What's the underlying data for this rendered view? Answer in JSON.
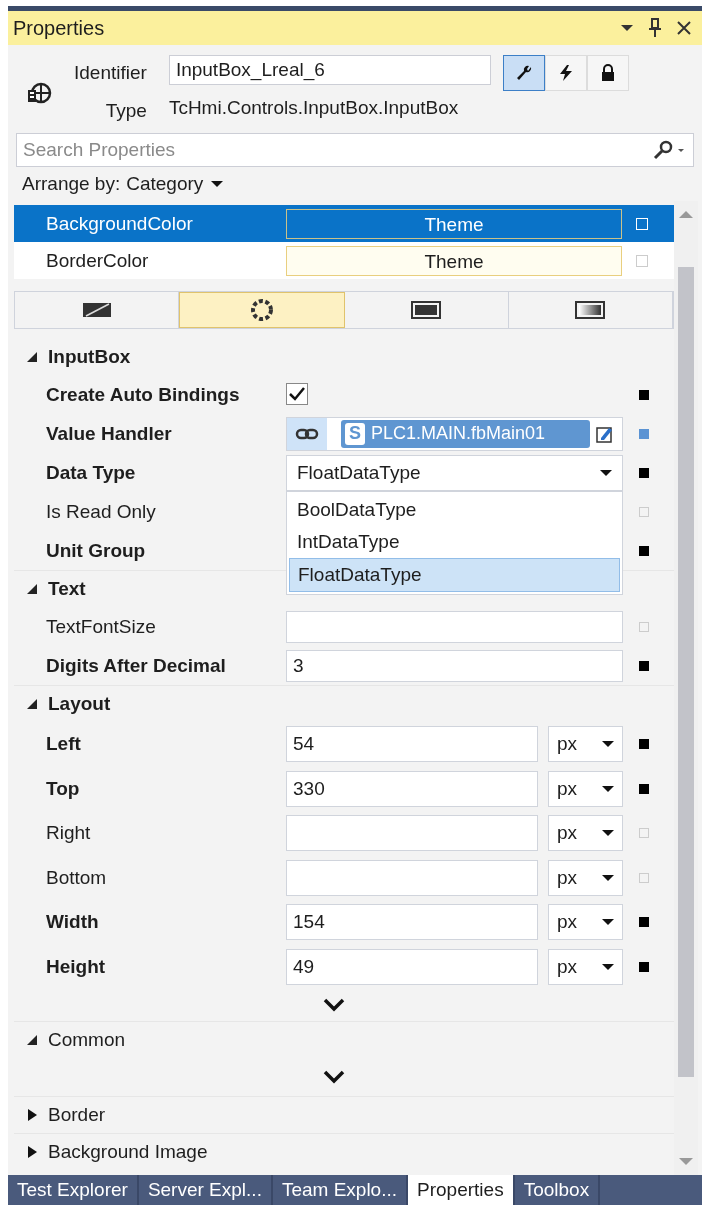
{
  "window": {
    "title": "Properties"
  },
  "header": {
    "identifier_label": "Identifier",
    "identifier": "InputBox_Lreal_6",
    "type_label": "Type",
    "type": "TcHmi.Controls.InputBox.InputBox",
    "views": [
      {
        "kind": "properties",
        "selected": true
      },
      {
        "kind": "events",
        "selected": false
      },
      {
        "kind": "permissions",
        "selected": false
      }
    ]
  },
  "search": {
    "placeholder": "Search Properties"
  },
  "arrange": {
    "label": "Arrange by:",
    "value": "Category"
  },
  "color_rows": [
    {
      "name": "BackgroundColor",
      "value": "Theme",
      "selected": true
    },
    {
      "name": "BorderColor",
      "value": "Theme",
      "selected": false
    }
  ],
  "brush_tabs": [
    {
      "kind": "none",
      "selected": false
    },
    {
      "kind": "theme",
      "selected": true
    },
    {
      "kind": "solid",
      "selected": false
    },
    {
      "kind": "gradient",
      "selected": false
    }
  ],
  "categories": [
    {
      "name": "InputBox",
      "expanded": true,
      "properties": [
        {
          "name": "Create Auto Bindings",
          "kind": "checkbox",
          "checked": true,
          "set": true,
          "bound": false
        },
        {
          "name": "Value Handler",
          "kind": "binding",
          "symbol": "S",
          "value": "PLC1.MAIN.fbMain01",
          "set": true,
          "bound": true
        },
        {
          "name": "Data Type",
          "kind": "dropdown",
          "value": "FloatDataType",
          "open": true,
          "set": true,
          "bound": false,
          "options": [
            {
              "label": "BoolDataType",
              "selected": false
            },
            {
              "label": "IntDataType",
              "selected": false
            },
            {
              "label": "FloatDataType",
              "selected": true
            }
          ]
        },
        {
          "name": "Is Read Only",
          "kind": "hidden",
          "set": false,
          "bound": false
        },
        {
          "name": "Unit Group",
          "kind": "hidden",
          "set": true,
          "bound": false
        }
      ]
    },
    {
      "name": "Text",
      "expanded": true,
      "properties": [
        {
          "name": "TextFontSize",
          "kind": "text",
          "set": false,
          "bound": false
        },
        {
          "name": "Digits After Decimal",
          "kind": "text",
          "value": "3",
          "set": true,
          "bound": false
        }
      ]
    },
    {
      "name": "Layout",
      "expanded": true,
      "more": true,
      "properties": [
        {
          "name": "Left",
          "kind": "unit",
          "value": "54",
          "unit": "px",
          "set": true,
          "bound": false
        },
        {
          "name": "Top",
          "kind": "unit",
          "value": "330",
          "unit": "px",
          "set": true,
          "bound": false
        },
        {
          "name": "Right",
          "kind": "unit",
          "unit": "px",
          "set": false,
          "bound": false
        },
        {
          "name": "Bottom",
          "kind": "unit",
          "unit": "px",
          "set": false,
          "bound": false
        },
        {
          "name": "Width",
          "kind": "unit",
          "value": "154",
          "unit": "px",
          "set": true,
          "bound": false
        },
        {
          "name": "Height",
          "kind": "unit",
          "value": "49",
          "unit": "px",
          "set": true,
          "bound": false
        }
      ]
    },
    {
      "name": "Common",
      "expanded": true,
      "more": true
    },
    {
      "name": "Border",
      "expanded": false
    },
    {
      "name": "Background Image",
      "expanded": false
    }
  ],
  "bottom_tabs": [
    {
      "label": "Test Explorer",
      "selected": false
    },
    {
      "label": "Server Expl...",
      "selected": false
    },
    {
      "label": "Team Explo...",
      "selected": false
    },
    {
      "label": "Properties",
      "selected": true
    },
    {
      "label": "Toolbox",
      "selected": false
    }
  ]
}
